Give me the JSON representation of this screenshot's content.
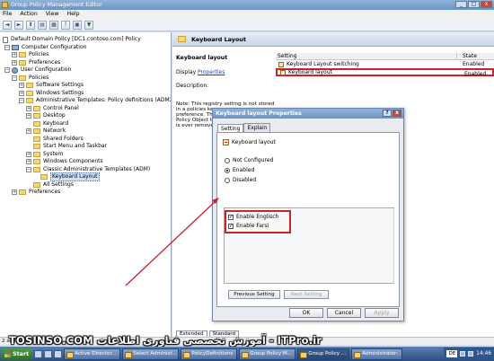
{
  "window": {
    "title": "Group Policy Management Editor",
    "min": "_",
    "max": "□",
    "close": "x"
  },
  "menu": [
    "File",
    "Action",
    "View",
    "Help"
  ],
  "toolbar": {
    "back": "◄",
    "forward": "►",
    "up": "⬆",
    "show": "▤",
    "props": "▦",
    "help": "?",
    "export": "▣",
    "filter": "▼"
  },
  "tree": {
    "root": "Default Domain Policy [DC1.contoso.com] Policy",
    "computer_config": "Computer Configuration",
    "cc_policies": "Policies",
    "cc_preferences": "Preferences",
    "user_config": "User Configuration",
    "uc_policies": "Policies",
    "software_settings": "Software Settings",
    "windows_settings": "Windows Settings",
    "admin_templates": "Administrative Templates: Policy definitions (ADMX files)",
    "control_panel": "Control Panel",
    "desktop": "Desktop",
    "keyboard": "Keyboard",
    "network": "Network",
    "shared_folders": "Shared Folders",
    "start_menu": "Start Menu and Taskbar",
    "system": "System",
    "windows_components": "Windows Components",
    "classic_templates": "Classic Administrative Templates (ADM)",
    "keyboard_layout": "Keyboard Layout",
    "all_settings": "All Settings",
    "uc_preferences": "Preferences"
  },
  "right": {
    "header": "Keyboard Layout",
    "title": "Keyboard layout",
    "display_prefix": "Display",
    "display_link": "Properties",
    "description": "Description:",
    "note_lines": [
      "Note:  This registry setting is not stored",
      "in a policies key",
      "preference. Th",
      "Policy Object th",
      "is ever removed"
    ],
    "columns": {
      "setting": "Setting",
      "state": "State"
    },
    "rows": [
      {
        "name": "Keyboard Layout switching",
        "state": "Enabled"
      },
      {
        "name": "Keyboard layout",
        "state": "Enabled"
      }
    ],
    "tabs": [
      "Extended",
      "Standard"
    ]
  },
  "dialog": {
    "title": "Keyboard layout Properties",
    "help": "?",
    "close": "x",
    "tabs": [
      "Setting",
      "Explain"
    ],
    "policy_name": "Keyboard layout",
    "radios": [
      "Not Configured",
      "Enabled",
      "Disabled"
    ],
    "selected_radio": 1,
    "options": [
      {
        "label": "Enable Englisch",
        "checked": true
      },
      {
        "label": "Enable Farsi",
        "checked": true
      }
    ],
    "previous_setting": "Previous Setting",
    "next_setting": "Next Setting",
    "ok": "OK",
    "cancel": "Cancel",
    "apply": "Apply"
  },
  "status": "2 setting(s)",
  "watermark": "TOSINSO.COM   آموزش تخصصی فناوری اطلاعات   -  ITPro.ir",
  "taskbar": {
    "start": "Start",
    "items": [
      "Active Director...",
      "Select Administ...",
      "PolicyDefinitions",
      "Group Policy M...",
      "Group Policy ...",
      "Administrator: ..."
    ],
    "active_index": 4,
    "lang": "DE",
    "clock": "14:46"
  },
  "colors": {
    "highlight_red": "#d0202a",
    "arrow_red": "#cc1f26"
  }
}
